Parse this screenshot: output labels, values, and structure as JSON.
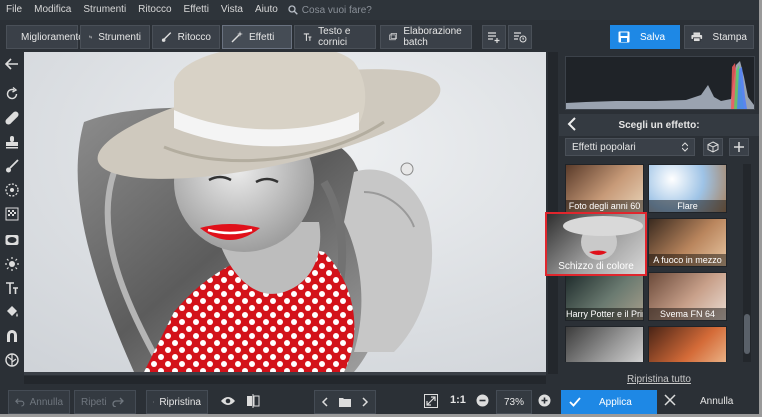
{
  "menu": [
    "File",
    "Modifica",
    "Strumenti",
    "Ritocco",
    "Effetti",
    "Vista",
    "Aiuto"
  ],
  "search": {
    "placeholder": "Cosa vuoi fare?"
  },
  "tabs": [
    {
      "label": "Miglioramento",
      "icon": "sliders-icon"
    },
    {
      "label": "Strumenti",
      "icon": "crop-icon"
    },
    {
      "label": "Ritocco",
      "icon": "brush-icon"
    },
    {
      "label": "Effetti",
      "icon": "wand-icon",
      "active": true
    },
    {
      "label": "Testo e cornici",
      "icon": "text-icon"
    },
    {
      "label": "Elaborazione batch",
      "icon": "batch-icon"
    }
  ],
  "toolbar": {
    "save_label": "Salva",
    "print_label": "Stampa"
  },
  "effects_panel": {
    "title": "Scegli un effetto:",
    "category": "Effetti popolari",
    "thumbnails": [
      {
        "label": "Foto degli anni 60"
      },
      {
        "label": "Flare"
      },
      {
        "label": "Schizzo di colore",
        "selected": true
      },
      {
        "label": "A fuoco in mezzo"
      },
      {
        "label": "Harry Potter e il Princip..."
      },
      {
        "label": "Svema FN 64"
      },
      {
        "label": ""
      },
      {
        "label": ""
      }
    ],
    "reset_all": "Ripristina tutto"
  },
  "bottom": {
    "undo": "Annulla",
    "redo": "Ripeti",
    "restore": "Ripristina",
    "zoom_ratio": "1:1",
    "zoom": "73%",
    "apply": "Applica",
    "cancel": "Annulla"
  },
  "colors": {
    "accent": "#1e88e5",
    "selection": "#e0262d",
    "bg": "#2b3036"
  }
}
